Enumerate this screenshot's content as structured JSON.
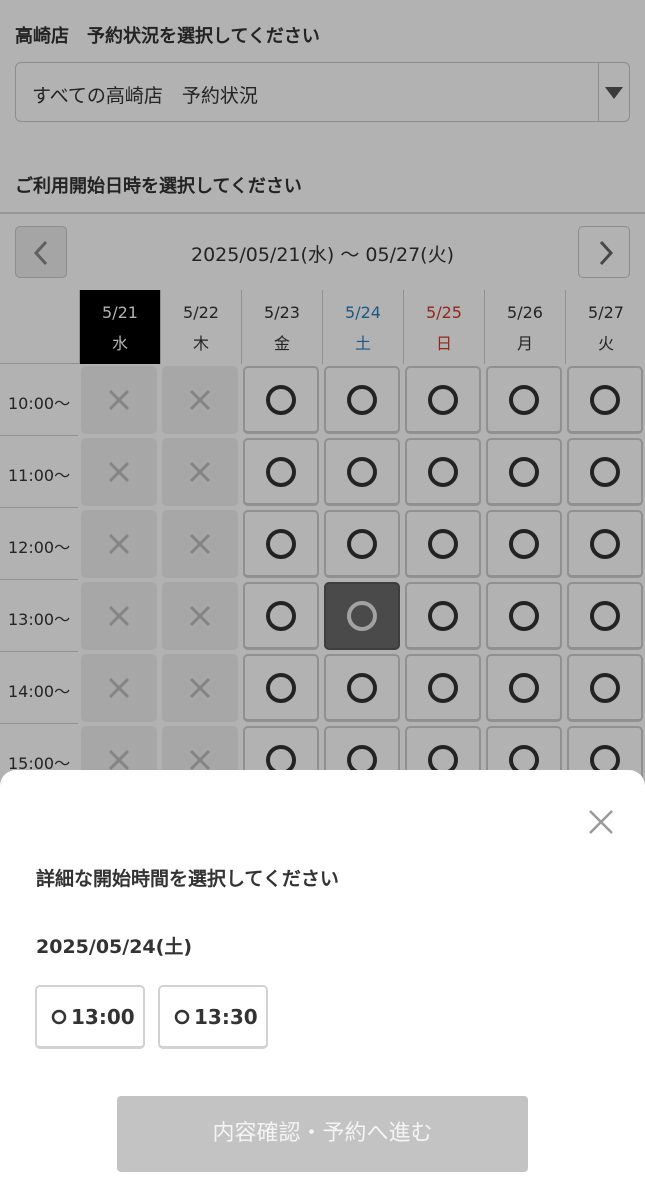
{
  "store_section": {
    "title": "高崎店　予約状況を選択してください",
    "select_value": "すべての高崎店　予約状況"
  },
  "date_section": {
    "title": "ご利用開始日時を選択してください",
    "range": "2025/05/21(水) 〜 05/27(火)"
  },
  "days": [
    {
      "date": "5/21",
      "weekday": "水",
      "kind": "today"
    },
    {
      "date": "5/22",
      "weekday": "木",
      "kind": "normal"
    },
    {
      "date": "5/23",
      "weekday": "金",
      "kind": "normal"
    },
    {
      "date": "5/24",
      "weekday": "土",
      "kind": "sat"
    },
    {
      "date": "5/25",
      "weekday": "日",
      "kind": "sun"
    },
    {
      "date": "5/26",
      "weekday": "月",
      "kind": "normal"
    },
    {
      "date": "5/27",
      "weekday": "火",
      "kind": "normal"
    }
  ],
  "times": [
    "10:00〜",
    "11:00〜",
    "12:00〜",
    "13:00〜",
    "14:00〜",
    "15:00〜"
  ],
  "availability": [
    [
      "x",
      "x",
      "o",
      "o",
      "o",
      "o",
      "o"
    ],
    [
      "x",
      "x",
      "o",
      "o",
      "o",
      "o",
      "o"
    ],
    [
      "x",
      "x",
      "o",
      "o",
      "o",
      "o",
      "o"
    ],
    [
      "x",
      "x",
      "o",
      "sel",
      "o",
      "o",
      "o"
    ],
    [
      "x",
      "x",
      "o",
      "o",
      "o",
      "o",
      "o"
    ],
    [
      "x",
      "x",
      "o",
      "o",
      "o",
      "o",
      "o"
    ]
  ],
  "sheet": {
    "title": "詳細な開始時間を選択してください",
    "date": "2025/05/24(土)",
    "slots": [
      "13:00",
      "13:30"
    ],
    "cta": "内容確認・予約へ進む"
  },
  "icons": {
    "prev": "chevron-left-icon",
    "next": "chevron-right-icon",
    "close": "close-icon",
    "available": "circle-icon",
    "unavailable": "cross-icon"
  }
}
